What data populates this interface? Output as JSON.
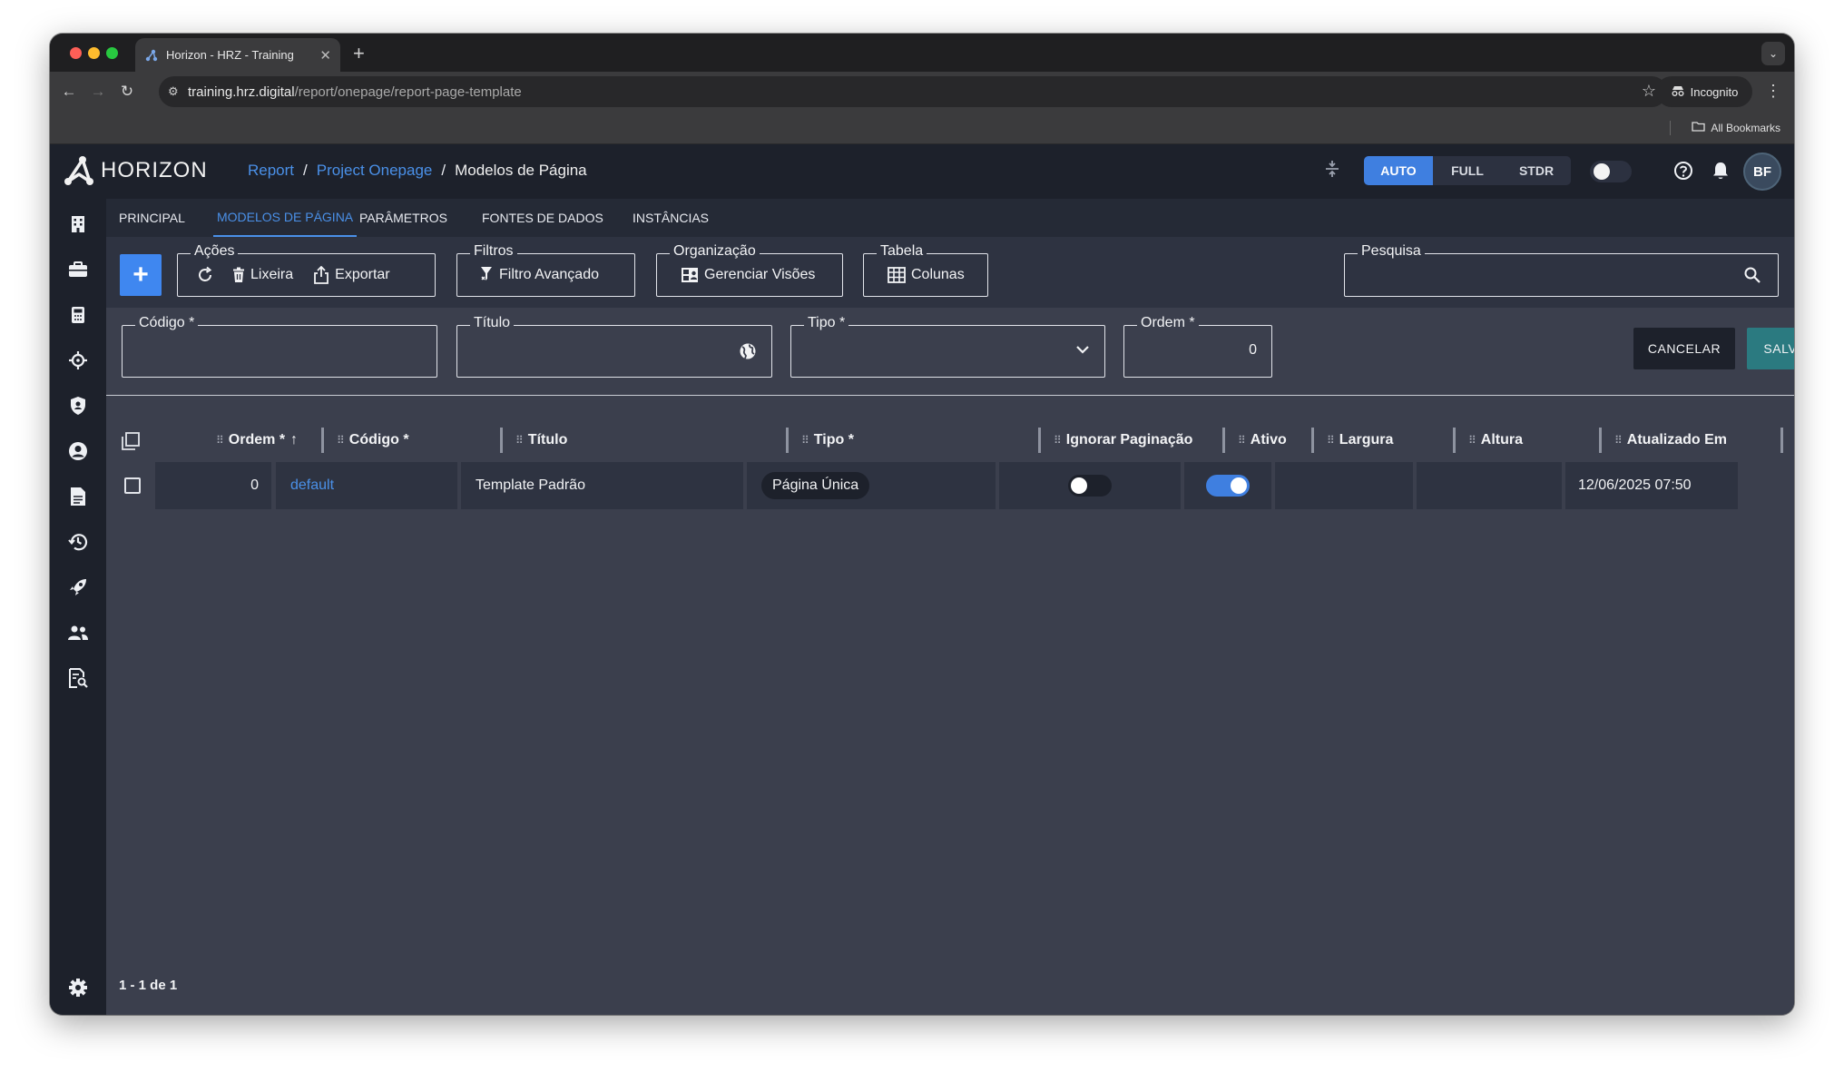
{
  "browser": {
    "tab_title": "Horizon - HRZ - Training",
    "url_host": "training.hrz.digital",
    "url_path": "/report/onepage/report-page-template",
    "incognito_label": "Incognito",
    "bookmarks_label": "All Bookmarks",
    "traffic_colors": [
      "#fe5f57",
      "#febc2e",
      "#28c840"
    ]
  },
  "app": {
    "logo_text": "HORIZON",
    "breadcrumb": [
      "Report",
      "Project Onepage",
      "Modelos de Página"
    ],
    "breadcrumb_sep": "/",
    "density_modes": [
      "AUTO",
      "FULL",
      "STDR"
    ],
    "active_density": "AUTO",
    "avatar_initials": "BF",
    "accent": "#3f7fe0",
    "save_color": "#2b7a80"
  },
  "sidebar": {
    "icons": [
      "building-icon",
      "briefcase-icon",
      "calculator-icon",
      "crosshair-icon",
      "shield-icon",
      "account-circle-icon",
      "document-icon",
      "history-icon",
      "rocket-icon",
      "people-icon",
      "search-document-icon"
    ],
    "settings_icon": "gear-icon"
  },
  "tabs": [
    "PRINCIPAL",
    "MODELOS DE PÁGINA",
    "PARÂMETROS",
    "FONTES DE DADOS",
    "INSTÂNCIAS"
  ],
  "active_tab": "MODELOS DE PÁGINA",
  "toolbox": {
    "actions_legend": "Ações",
    "trash_label": "Lixeira",
    "export_label": "Exportar",
    "filters_legend": "Filtros",
    "advanced_filter_label": "Filtro Avançado",
    "organization_legend": "Organização",
    "manage_views_label": "Gerenciar Visões",
    "table_legend": "Tabela",
    "columns_label": "Colunas",
    "search_legend": "Pesquisa",
    "search_value": ""
  },
  "form": {
    "code_label": "Código *",
    "code_value": "",
    "title_label": "Título",
    "title_value": "",
    "type_label": "Tipo *",
    "type_value": "",
    "order_label": "Ordem *",
    "order_value": "0",
    "cancel_label": "CANCELAR",
    "save_label": "SALVAR"
  },
  "table": {
    "columns": [
      "Ordem *",
      "Código *",
      "Título",
      "Tipo *",
      "Ignorar Paginação",
      "Ativo",
      "Largura",
      "Altura",
      "Atualizado Em"
    ],
    "rows": [
      {
        "ordem": "0",
        "codigo": "default",
        "titulo": "Template Padrão",
        "tipo": "Página Única",
        "ignorar_paginacao": false,
        "ativo": true,
        "largura": "",
        "altura": "",
        "atualizado_em": "12/06/2025 07:50"
      }
    ]
  },
  "pagination": "1 - 1 de 1"
}
